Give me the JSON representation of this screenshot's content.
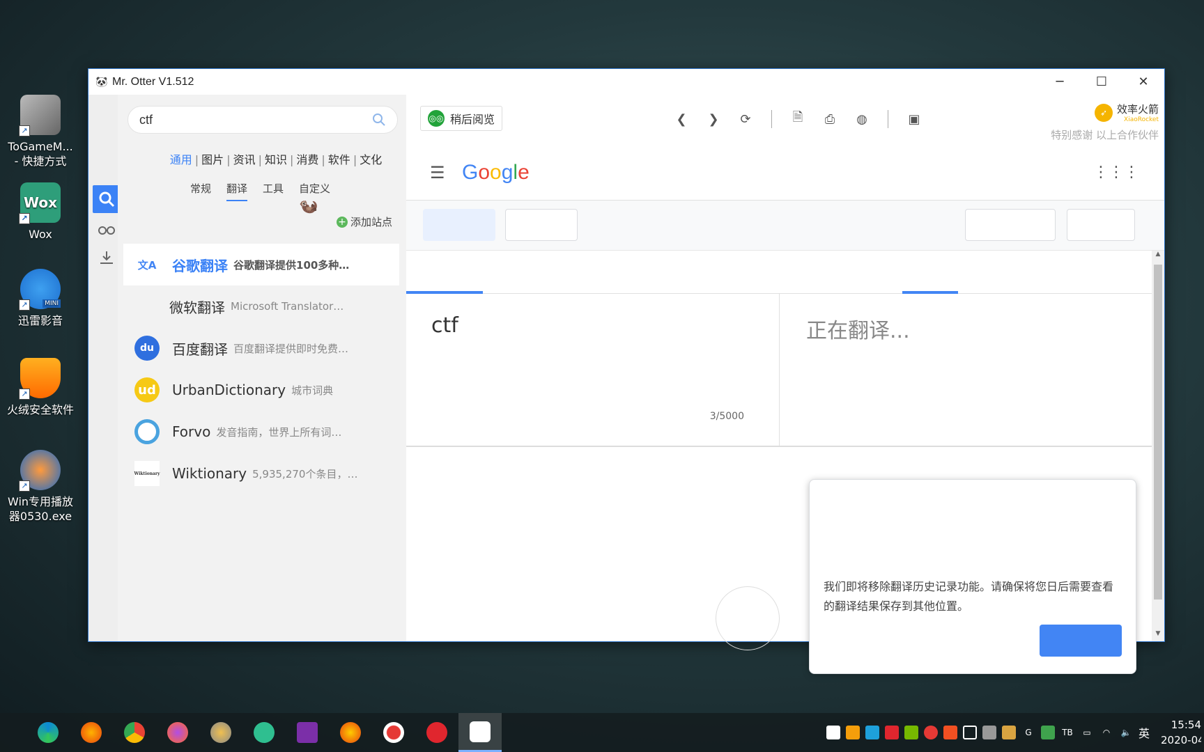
{
  "desktop": {
    "icons": [
      {
        "label": "ToGameM...\n- 快捷方式",
        "line1": "ToGameM...",
        "line2": "- 快捷方式"
      },
      {
        "label": "Wox",
        "line1": "Wox",
        "line2": ""
      },
      {
        "label": "迅雷影音",
        "line1": "迅雷影音",
        "line2": ""
      },
      {
        "label": "火绒安全软件",
        "line1": "火绒安全软件",
        "line2": ""
      },
      {
        "label": "Win专用播放器0530.exe",
        "line1": "Win专用播放",
        "line2": "器0530.exe"
      }
    ],
    "wox_badge": "Wox",
    "mini_badge": "MINI"
  },
  "window": {
    "title": "Mr. Otter V1.512",
    "minimize": "─",
    "maximize": "☐",
    "close": "✕"
  },
  "left_panel": {
    "search_value": "ctf",
    "categories": [
      "通用",
      "图片",
      "资讯",
      "知识",
      "消费",
      "软件",
      "文化"
    ],
    "subcategories": [
      "常规",
      "翻译",
      "工具",
      "自定义"
    ],
    "add_site": "添加站点",
    "sites": [
      {
        "name": "谷歌翻译",
        "desc": "谷歌翻译提供100多种…",
        "logo": "文A"
      },
      {
        "name": "微软翻译",
        "desc": "Microsoft Translator…",
        "logo": ""
      },
      {
        "name": "百度翻译",
        "desc": "百度翻译提供即时免费…",
        "logo": "du"
      },
      {
        "name": "UrbanDictionary",
        "desc": "城市词典",
        "logo": "ud"
      },
      {
        "name": "Forvo",
        "desc": "发音指南，世界上所有词…",
        "logo": ""
      },
      {
        "name": "Wiktionary",
        "desc": "5,935,270个条目，…",
        "logo": "Wiktionary"
      }
    ]
  },
  "toolbar": {
    "read_later": "稍后阅览",
    "sponsor_brand": "效率火箭",
    "sponsor_sub": "XiaoRocket",
    "sponsor_thanks": "特别感谢 以上合作伙伴"
  },
  "google": {
    "logo_letters": [
      {
        "ch": "G",
        "color": "#4285F4"
      },
      {
        "ch": "o",
        "color": "#EA4335"
      },
      {
        "ch": "o",
        "color": "#FBBC05"
      },
      {
        "ch": "g",
        "color": "#4285F4"
      },
      {
        "ch": "l",
        "color": "#34A853"
      },
      {
        "ch": "e",
        "color": "#EA4335"
      }
    ],
    "source_text": "ctf",
    "char_count": "3/5000",
    "target_text": "正在翻译...",
    "dialog_message": "我们即将移除翻译历史记录功能。请确保将您日后需要查看的翻译结果保存到其他位置。"
  },
  "taskbar": {
    "ime": "英",
    "time": "15:54",
    "date": "2020-04"
  }
}
